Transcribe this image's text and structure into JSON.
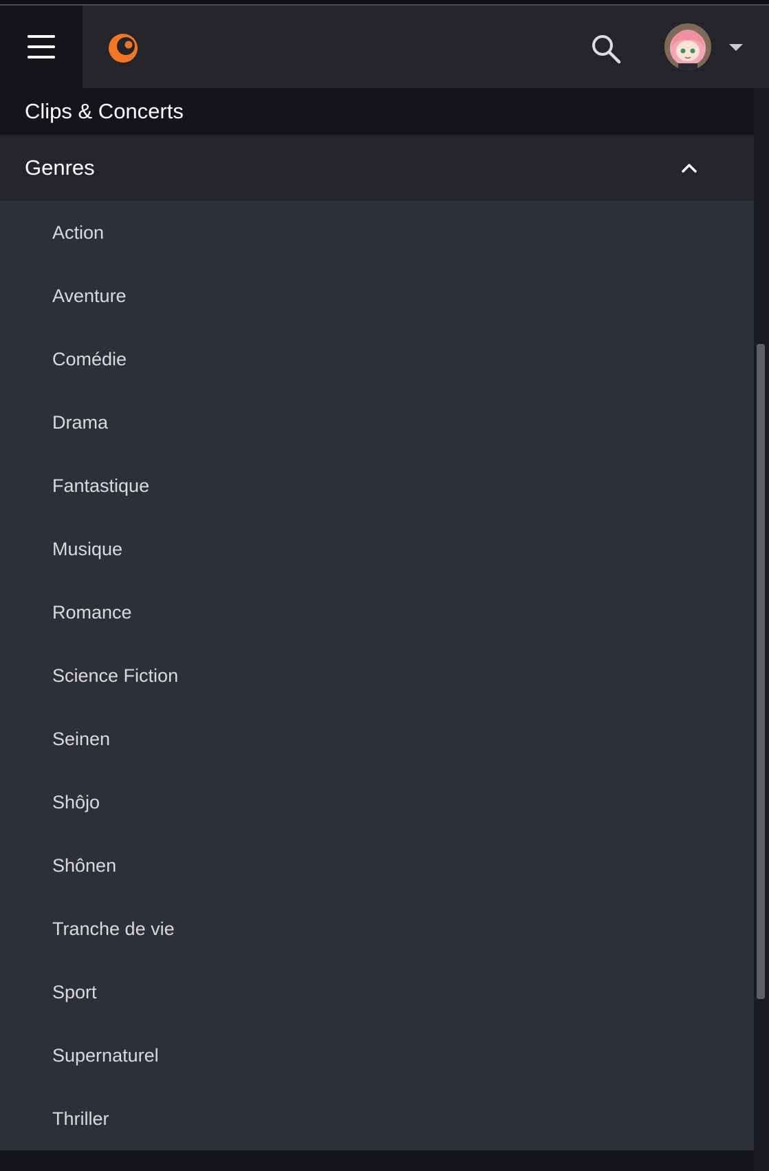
{
  "header": {
    "menu_icon": "hamburger-menu-icon",
    "logo_icon": "crunchyroll-logo-icon",
    "search_icon": "search-icon",
    "avatar": "user-avatar",
    "caret_icon": "caret-down-icon",
    "accent_color": "#F47521"
  },
  "drawer": {
    "clips_label": "Clips & Concerts",
    "genres_label": "Genres",
    "genres_expanded": true,
    "genres_chevron_icon": "chevron-up-icon",
    "genres": [
      "Action",
      "Aventure",
      "Comédie",
      "Drama",
      "Fantastique",
      "Musique",
      "Romance",
      "Science Fiction",
      "Seinen",
      "Shôjo",
      "Shônen",
      "Tranche de vie",
      "Sport",
      "Supernaturel",
      "Thriller"
    ]
  }
}
